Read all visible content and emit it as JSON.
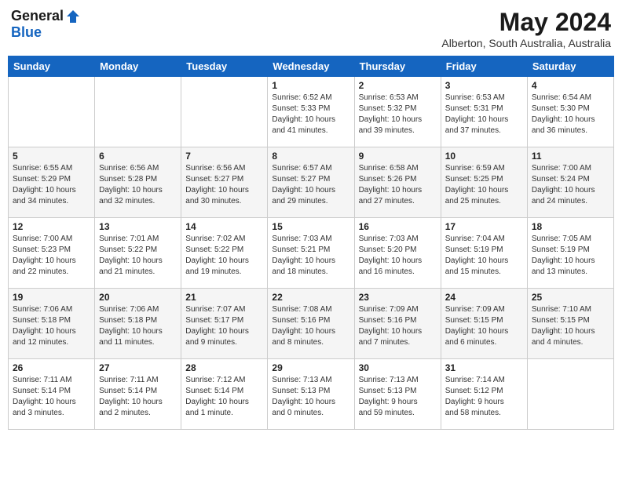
{
  "header": {
    "logo_general": "General",
    "logo_blue": "Blue",
    "month_year": "May 2024",
    "location": "Alberton, South Australia, Australia"
  },
  "days_of_week": [
    "Sunday",
    "Monday",
    "Tuesday",
    "Wednesday",
    "Thursday",
    "Friday",
    "Saturday"
  ],
  "weeks": [
    [
      {
        "day": "",
        "info": ""
      },
      {
        "day": "",
        "info": ""
      },
      {
        "day": "",
        "info": ""
      },
      {
        "day": "1",
        "info": "Sunrise: 6:52 AM\nSunset: 5:33 PM\nDaylight: 10 hours\nand 41 minutes."
      },
      {
        "day": "2",
        "info": "Sunrise: 6:53 AM\nSunset: 5:32 PM\nDaylight: 10 hours\nand 39 minutes."
      },
      {
        "day": "3",
        "info": "Sunrise: 6:53 AM\nSunset: 5:31 PM\nDaylight: 10 hours\nand 37 minutes."
      },
      {
        "day": "4",
        "info": "Sunrise: 6:54 AM\nSunset: 5:30 PM\nDaylight: 10 hours\nand 36 minutes."
      }
    ],
    [
      {
        "day": "5",
        "info": "Sunrise: 6:55 AM\nSunset: 5:29 PM\nDaylight: 10 hours\nand 34 minutes."
      },
      {
        "day": "6",
        "info": "Sunrise: 6:56 AM\nSunset: 5:28 PM\nDaylight: 10 hours\nand 32 minutes."
      },
      {
        "day": "7",
        "info": "Sunrise: 6:56 AM\nSunset: 5:27 PM\nDaylight: 10 hours\nand 30 minutes."
      },
      {
        "day": "8",
        "info": "Sunrise: 6:57 AM\nSunset: 5:27 PM\nDaylight: 10 hours\nand 29 minutes."
      },
      {
        "day": "9",
        "info": "Sunrise: 6:58 AM\nSunset: 5:26 PM\nDaylight: 10 hours\nand 27 minutes."
      },
      {
        "day": "10",
        "info": "Sunrise: 6:59 AM\nSunset: 5:25 PM\nDaylight: 10 hours\nand 25 minutes."
      },
      {
        "day": "11",
        "info": "Sunrise: 7:00 AM\nSunset: 5:24 PM\nDaylight: 10 hours\nand 24 minutes."
      }
    ],
    [
      {
        "day": "12",
        "info": "Sunrise: 7:00 AM\nSunset: 5:23 PM\nDaylight: 10 hours\nand 22 minutes."
      },
      {
        "day": "13",
        "info": "Sunrise: 7:01 AM\nSunset: 5:22 PM\nDaylight: 10 hours\nand 21 minutes."
      },
      {
        "day": "14",
        "info": "Sunrise: 7:02 AM\nSunset: 5:22 PM\nDaylight: 10 hours\nand 19 minutes."
      },
      {
        "day": "15",
        "info": "Sunrise: 7:03 AM\nSunset: 5:21 PM\nDaylight: 10 hours\nand 18 minutes."
      },
      {
        "day": "16",
        "info": "Sunrise: 7:03 AM\nSunset: 5:20 PM\nDaylight: 10 hours\nand 16 minutes."
      },
      {
        "day": "17",
        "info": "Sunrise: 7:04 AM\nSunset: 5:19 PM\nDaylight: 10 hours\nand 15 minutes."
      },
      {
        "day": "18",
        "info": "Sunrise: 7:05 AM\nSunset: 5:19 PM\nDaylight: 10 hours\nand 13 minutes."
      }
    ],
    [
      {
        "day": "19",
        "info": "Sunrise: 7:06 AM\nSunset: 5:18 PM\nDaylight: 10 hours\nand 12 minutes."
      },
      {
        "day": "20",
        "info": "Sunrise: 7:06 AM\nSunset: 5:18 PM\nDaylight: 10 hours\nand 11 minutes."
      },
      {
        "day": "21",
        "info": "Sunrise: 7:07 AM\nSunset: 5:17 PM\nDaylight: 10 hours\nand 9 minutes."
      },
      {
        "day": "22",
        "info": "Sunrise: 7:08 AM\nSunset: 5:16 PM\nDaylight: 10 hours\nand 8 minutes."
      },
      {
        "day": "23",
        "info": "Sunrise: 7:09 AM\nSunset: 5:16 PM\nDaylight: 10 hours\nand 7 minutes."
      },
      {
        "day": "24",
        "info": "Sunrise: 7:09 AM\nSunset: 5:15 PM\nDaylight: 10 hours\nand 6 minutes."
      },
      {
        "day": "25",
        "info": "Sunrise: 7:10 AM\nSunset: 5:15 PM\nDaylight: 10 hours\nand 4 minutes."
      }
    ],
    [
      {
        "day": "26",
        "info": "Sunrise: 7:11 AM\nSunset: 5:14 PM\nDaylight: 10 hours\nand 3 minutes."
      },
      {
        "day": "27",
        "info": "Sunrise: 7:11 AM\nSunset: 5:14 PM\nDaylight: 10 hours\nand 2 minutes."
      },
      {
        "day": "28",
        "info": "Sunrise: 7:12 AM\nSunset: 5:14 PM\nDaylight: 10 hours\nand 1 minute."
      },
      {
        "day": "29",
        "info": "Sunrise: 7:13 AM\nSunset: 5:13 PM\nDaylight: 10 hours\nand 0 minutes."
      },
      {
        "day": "30",
        "info": "Sunrise: 7:13 AM\nSunset: 5:13 PM\nDaylight: 9 hours\nand 59 minutes."
      },
      {
        "day": "31",
        "info": "Sunrise: 7:14 AM\nSunset: 5:12 PM\nDaylight: 9 hours\nand 58 minutes."
      },
      {
        "day": "",
        "info": ""
      }
    ]
  ]
}
